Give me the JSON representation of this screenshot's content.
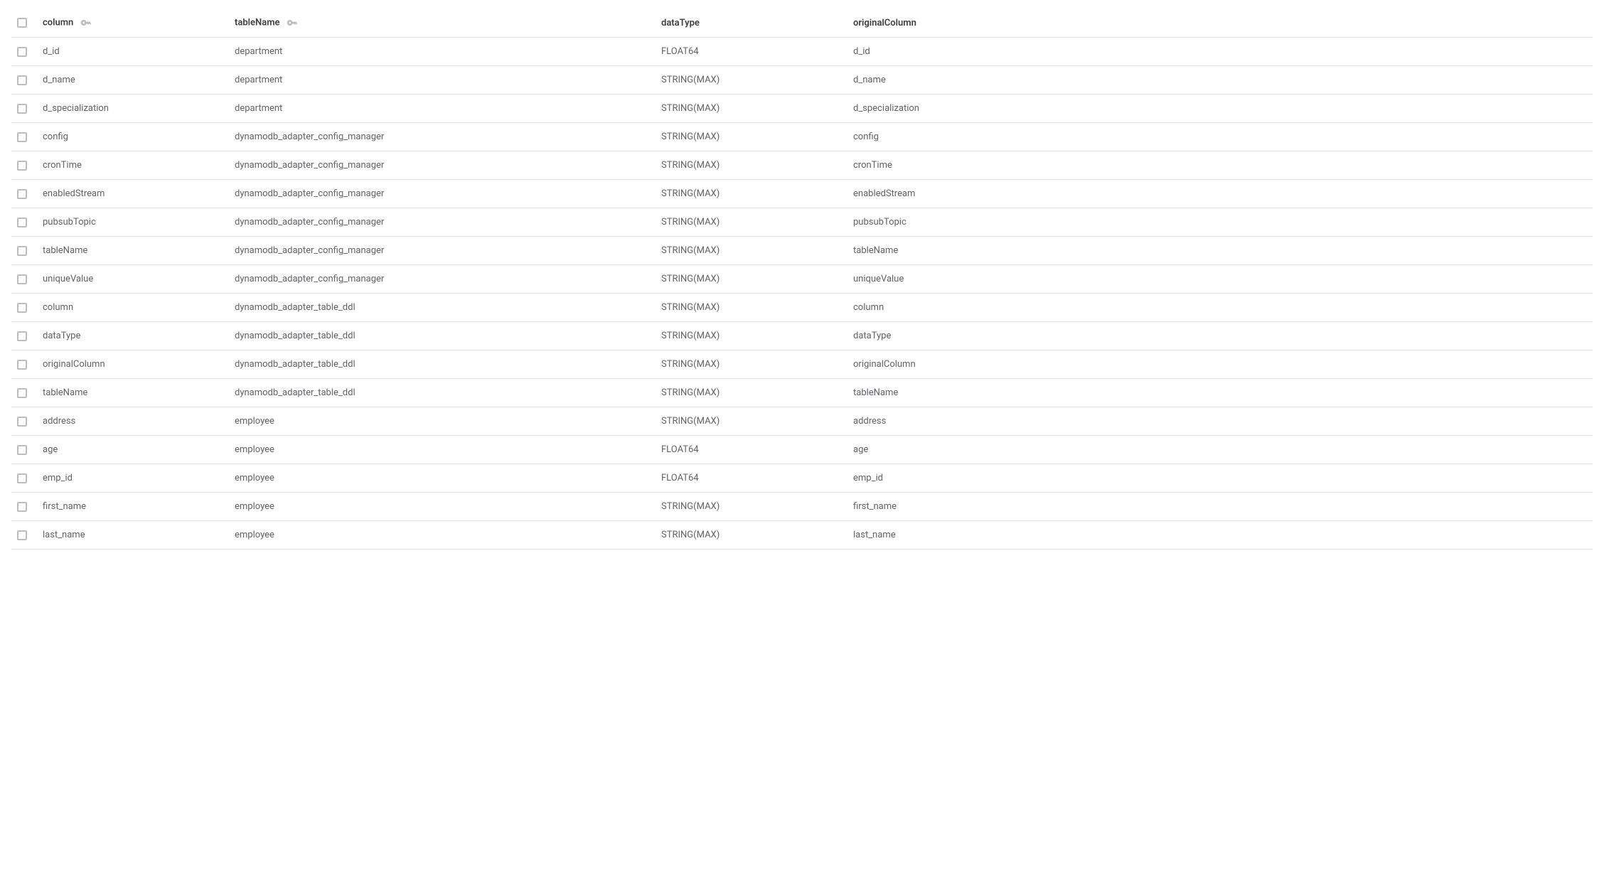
{
  "table": {
    "headers": {
      "column": "column",
      "tableName": "tableName",
      "dataType": "dataType",
      "originalColumn": "originalColumn"
    },
    "rows": [
      {
        "column": "d_id",
        "tableName": "department",
        "dataType": "FLOAT64",
        "originalColumn": "d_id"
      },
      {
        "column": "d_name",
        "tableName": "department",
        "dataType": "STRING(MAX)",
        "originalColumn": "d_name"
      },
      {
        "column": "d_specialization",
        "tableName": "department",
        "dataType": "STRING(MAX)",
        "originalColumn": "d_specialization"
      },
      {
        "column": "config",
        "tableName": "dynamodb_adapter_config_manager",
        "dataType": "STRING(MAX)",
        "originalColumn": "config"
      },
      {
        "column": "cronTime",
        "tableName": "dynamodb_adapter_config_manager",
        "dataType": "STRING(MAX)",
        "originalColumn": "cronTime"
      },
      {
        "column": "enabledStream",
        "tableName": "dynamodb_adapter_config_manager",
        "dataType": "STRING(MAX)",
        "originalColumn": "enabledStream"
      },
      {
        "column": "pubsubTopic",
        "tableName": "dynamodb_adapter_config_manager",
        "dataType": "STRING(MAX)",
        "originalColumn": "pubsubTopic"
      },
      {
        "column": "tableName",
        "tableName": "dynamodb_adapter_config_manager",
        "dataType": "STRING(MAX)",
        "originalColumn": "tableName"
      },
      {
        "column": "uniqueValue",
        "tableName": "dynamodb_adapter_config_manager",
        "dataType": "STRING(MAX)",
        "originalColumn": "uniqueValue"
      },
      {
        "column": "column",
        "tableName": "dynamodb_adapter_table_ddl",
        "dataType": "STRING(MAX)",
        "originalColumn": "column"
      },
      {
        "column": "dataType",
        "tableName": "dynamodb_adapter_table_ddl",
        "dataType": "STRING(MAX)",
        "originalColumn": "dataType"
      },
      {
        "column": "originalColumn",
        "tableName": "dynamodb_adapter_table_ddl",
        "dataType": "STRING(MAX)",
        "originalColumn": "originalColumn"
      },
      {
        "column": "tableName",
        "tableName": "dynamodb_adapter_table_ddl",
        "dataType": "STRING(MAX)",
        "originalColumn": "tableName"
      },
      {
        "column": "address",
        "tableName": "employee",
        "dataType": "STRING(MAX)",
        "originalColumn": "address"
      },
      {
        "column": "age",
        "tableName": "employee",
        "dataType": "FLOAT64",
        "originalColumn": "age"
      },
      {
        "column": "emp_id",
        "tableName": "employee",
        "dataType": "FLOAT64",
        "originalColumn": "emp_id"
      },
      {
        "column": "first_name",
        "tableName": "employee",
        "dataType": "STRING(MAX)",
        "originalColumn": "first_name"
      },
      {
        "column": "last_name",
        "tableName": "employee",
        "dataType": "STRING(MAX)",
        "originalColumn": "last_name"
      }
    ]
  }
}
